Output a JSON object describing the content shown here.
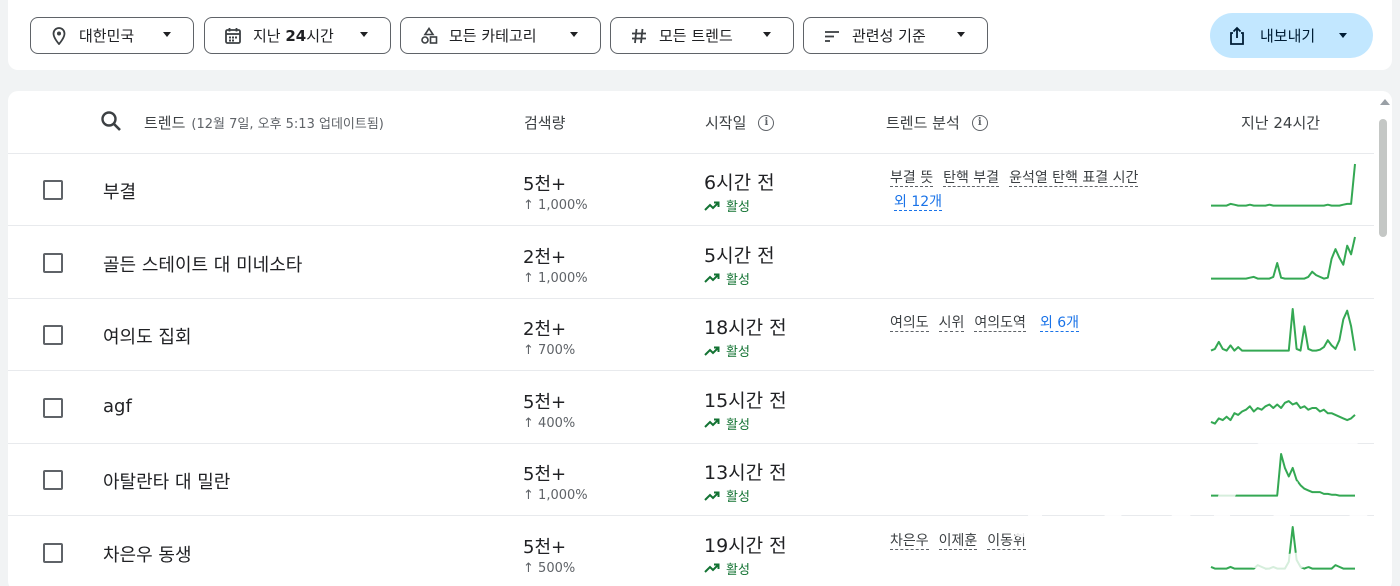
{
  "filters": {
    "region": "대한민국",
    "period_prefix": "지난 ",
    "period_num": "24",
    "period_suffix": "시간",
    "category": "모든 카테고리",
    "trend_type": "모든 트렌드",
    "sort": "관련성 기준",
    "export": "내보내기"
  },
  "header": {
    "trend": "트렌드",
    "updated": "(12월 7일, 오후 5:13 업데이트됨)",
    "volume": "검색량",
    "started": "시작일",
    "breakdown": "트렌드 분석",
    "past": "지난 24시간"
  },
  "active_label": "활성",
  "rows": [
    {
      "title": "부결",
      "volume": "5천+",
      "change": "1,000%",
      "started": "6시간 전",
      "keywords": [
        "부결 뜻",
        "탄핵 부결",
        "윤석열 탄핵 표결 시간"
      ],
      "more": "외 12개"
    },
    {
      "title": "골든 스테이트 대 미네소타",
      "volume": "2천+",
      "change": "1,000%",
      "started": "5시간 전",
      "keywords": [],
      "more": ""
    },
    {
      "title": "여의도 집회",
      "volume": "2천+",
      "change": "700%",
      "started": "18시간 전",
      "keywords": [
        "여의도",
        "시위",
        "여의도역"
      ],
      "more": "외 6개"
    },
    {
      "title": "agf",
      "volume": "5천+",
      "change": "400%",
      "started": "15시간 전",
      "keywords": [],
      "more": ""
    },
    {
      "title": "아탈란타 대 밀란",
      "volume": "5천+",
      "change": "1,000%",
      "started": "13시간 전",
      "keywords": [],
      "more": ""
    },
    {
      "title": "차은우 동생",
      "volume": "5천+",
      "change": "500%",
      "started": "19시간 전",
      "keywords": [
        "차은우",
        "이제훈",
        "이동휘"
      ],
      "more": ""
    }
  ],
  "sparklines": [
    [
      12,
      12,
      12,
      12,
      12,
      14,
      13,
      12,
      12,
      12,
      13,
      12,
      12,
      12,
      12,
      13,
      12,
      12,
      12,
      12,
      12,
      12,
      12,
      12,
      12,
      12,
      12,
      12,
      12,
      12,
      13,
      12,
      12,
      12,
      13,
      14,
      14,
      60
    ],
    [
      12,
      12,
      12,
      12,
      12,
      12,
      12,
      12,
      12,
      12,
      13,
      14,
      12,
      12,
      12,
      12,
      14,
      30,
      13,
      12,
      12,
      12,
      12,
      12,
      12,
      14,
      20,
      16,
      14,
      12,
      13,
      35,
      46,
      36,
      28,
      50,
      40,
      60
    ],
    [
      12,
      14,
      22,
      14,
      12,
      18,
      12,
      16,
      12,
      12,
      12,
      12,
      12,
      12,
      12,
      12,
      12,
      12,
      12,
      12,
      12,
      60,
      14,
      12,
      40,
      14,
      12,
      12,
      13,
      16,
      24,
      18,
      14,
      24,
      48,
      58,
      40,
      12
    ],
    [
      14,
      12,
      18,
      16,
      20,
      16,
      24,
      22,
      26,
      28,
      32,
      26,
      30,
      28,
      32,
      34,
      30,
      34,
      30,
      36,
      38,
      34,
      36,
      30,
      32,
      28,
      30,
      30,
      26,
      28,
      24,
      24,
      22,
      20,
      18,
      16,
      18,
      22
    ],
    [
      12,
      12,
      12,
      12,
      12,
      12,
      12,
      12,
      12,
      12,
      12,
      12,
      12,
      12,
      12,
      12,
      12,
      12,
      60,
      44,
      34,
      44,
      30,
      24,
      20,
      18,
      16,
      16,
      16,
      14,
      14,
      13,
      13,
      12,
      12,
      12,
      12,
      12
    ],
    [
      14,
      12,
      12,
      12,
      12,
      14,
      12,
      12,
      12,
      12,
      12,
      12,
      16,
      14,
      12,
      12,
      14,
      12,
      12,
      12,
      20,
      60,
      22,
      14,
      12,
      14,
      12,
      12,
      12,
      12,
      12,
      12,
      16,
      14,
      12,
      12,
      12,
      12
    ]
  ],
  "watermark": "뉴스1"
}
